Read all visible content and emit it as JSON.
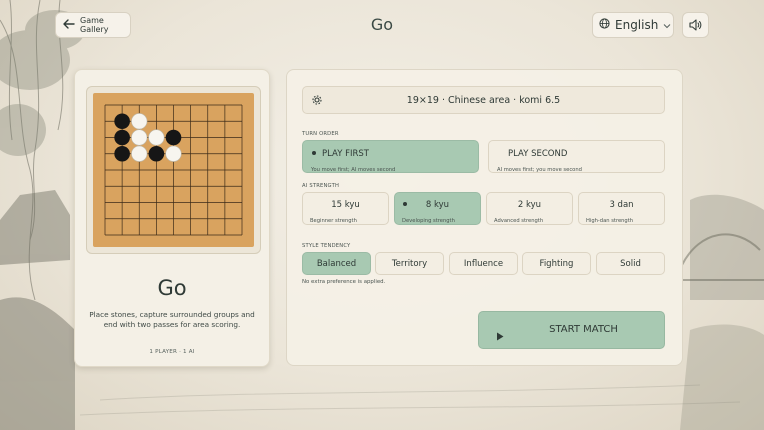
{
  "header": {
    "back_label": "Game Gallery",
    "title": "Go",
    "language": "English"
  },
  "icons": {
    "back": "arrow-left-icon",
    "language": "globe-icon",
    "language_dropdown": "chevron-down-icon",
    "sound": "speaker-icon",
    "rules": "settings-gear-icon",
    "start": "play-icon"
  },
  "game_card": {
    "title": "Go",
    "description": "Place stones, capture surrounded groups and end with two passes for area scoring.",
    "meta": "1 PLAYER · 1 AI"
  },
  "board": {
    "size": 9,
    "black_stones": [
      [
        1,
        1
      ],
      [
        2,
        1
      ],
      [
        3,
        1
      ],
      [
        3,
        3
      ],
      [
        2,
        4
      ]
    ],
    "white_stones": [
      [
        1,
        2
      ],
      [
        2,
        2
      ],
      [
        3,
        2
      ],
      [
        2,
        3
      ],
      [
        3,
        4
      ]
    ]
  },
  "settings": {
    "rules_summary": "19×19 · Chinese area · komi 6.5",
    "turn_order": {
      "label": "TURN ORDER",
      "options": [
        {
          "label": "PLAY FIRST",
          "sub": "You move first; AI moves second",
          "selected": true
        },
        {
          "label": "PLAY SECOND",
          "sub": "AI moves first; you move second",
          "selected": false
        }
      ]
    },
    "ai_strength": {
      "label": "AI STRENGTH",
      "options": [
        {
          "label": "15 kyu",
          "sub": "Beginner strength",
          "selected": false
        },
        {
          "label": "8 kyu",
          "sub": "Developing strength",
          "selected": true
        },
        {
          "label": "2 kyu",
          "sub": "Advanced strength",
          "selected": false
        },
        {
          "label": "3 dan",
          "sub": "High-dan strength",
          "selected": false
        }
      ]
    },
    "style": {
      "label": "STYLE TENDENCY",
      "options": [
        {
          "label": "Balanced",
          "selected": true
        },
        {
          "label": "Territory",
          "selected": false
        },
        {
          "label": "Influence",
          "selected": false
        },
        {
          "label": "Fighting",
          "selected": false
        },
        {
          "label": "Solid",
          "selected": false
        }
      ],
      "note": "No extra preference is applied."
    },
    "start_label": "START MATCH"
  },
  "colors": {
    "accent": "#a8c9b2",
    "board_wood": "#d9a35f",
    "board_line": "#3b2a18",
    "stone_black": "#161616",
    "stone_white": "#f7f5ef"
  }
}
